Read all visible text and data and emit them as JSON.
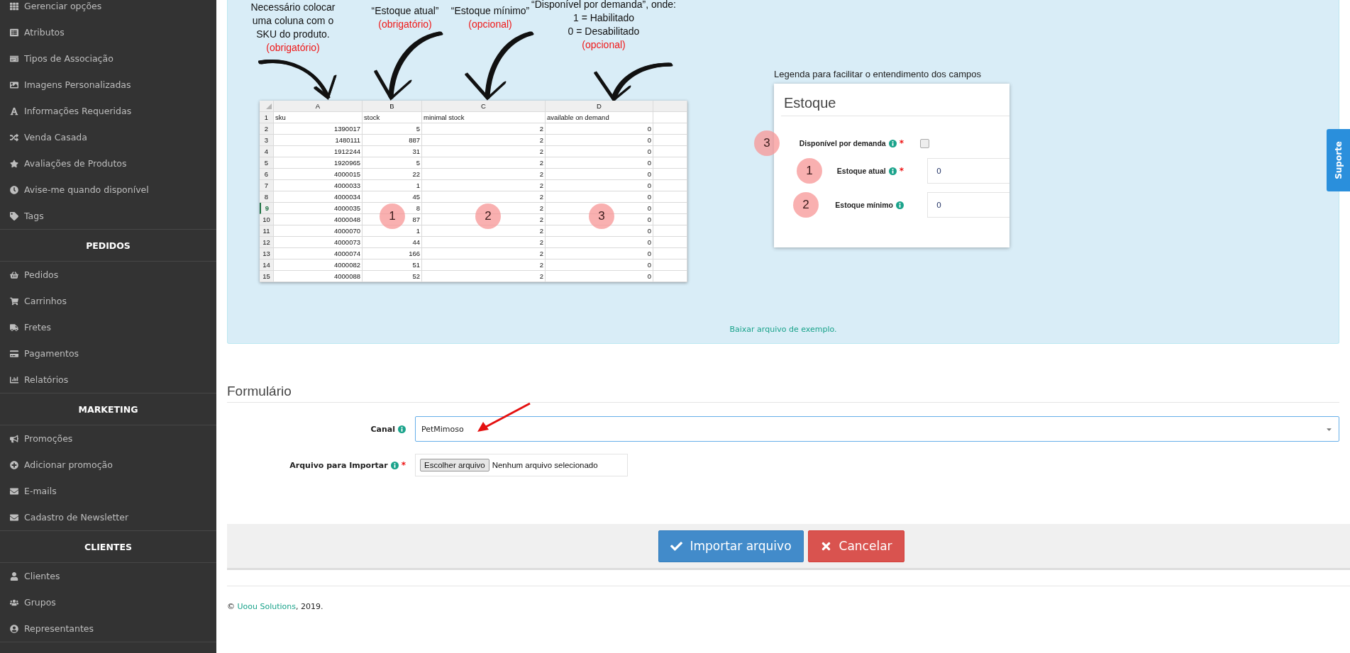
{
  "sidebar": {
    "sections": [
      {
        "items": [
          {
            "label": "Gerenciar opções"
          },
          {
            "label": "Atributos"
          },
          {
            "label": "Tipos de Associação"
          },
          {
            "label": "Imagens Personalizadas"
          },
          {
            "label": "Informações Requeridas"
          },
          {
            "label": "Venda Casada"
          },
          {
            "label": "Avaliações de Produtos"
          },
          {
            "label": "Avise-me quando disponível"
          },
          {
            "label": "Tags"
          }
        ]
      },
      {
        "title": "PEDIDOS",
        "items": [
          {
            "label": "Pedidos"
          },
          {
            "label": "Carrinhos"
          },
          {
            "label": "Fretes"
          },
          {
            "label": "Pagamentos"
          },
          {
            "label": "Relatórios"
          }
        ]
      },
      {
        "title": "MARKETING",
        "items": [
          {
            "label": "Promoções"
          },
          {
            "label": "Adicionar promoção"
          },
          {
            "label": "E-mails"
          },
          {
            "label": "Cadastro de Newsletter"
          }
        ]
      },
      {
        "title": "CLIENTES",
        "items": [
          {
            "label": "Clientes"
          },
          {
            "label": "Grupos"
          },
          {
            "label": "Representantes"
          }
        ]
      }
    ]
  },
  "instructions": {
    "notes": [
      {
        "lines": [
          "Necessário colocar",
          "uma coluna com o",
          "SKU do produto."
        ],
        "tag": "(obrigatório)"
      },
      {
        "lines": [
          "“Estoque atual”"
        ],
        "tag": "(obrigatório)"
      },
      {
        "lines": [
          "“Estoque mínimo”"
        ],
        "tag": "(opcional)"
      },
      {
        "lines": [
          "“Disponível por demanda”, onde:",
          "1 = Habilitado",
          "0 = Desabilitado"
        ],
        "tag": "(opcional)"
      }
    ],
    "spreadsheet": {
      "columns": [
        "A",
        "B",
        "C",
        "D"
      ],
      "rows": [
        {
          "cells": [
            "1",
            "sku",
            "stock",
            "minimal stock",
            "available on demand"
          ],
          "selected": false
        },
        {
          "cells": [
            "2",
            "1390017",
            "5",
            "2",
            "0"
          ],
          "selected": false
        },
        {
          "cells": [
            "3",
            "1480111",
            "887",
            "2",
            "0"
          ],
          "selected": false
        },
        {
          "cells": [
            "4",
            "1912244",
            "31",
            "2",
            "0"
          ],
          "selected": false
        },
        {
          "cells": [
            "5",
            "1920965",
            "5",
            "2",
            "0"
          ],
          "selected": false
        },
        {
          "cells": [
            "6",
            "4000015",
            "22",
            "2",
            "0"
          ],
          "selected": false
        },
        {
          "cells": [
            "7",
            "4000033",
            "1",
            "2",
            "0"
          ],
          "selected": false
        },
        {
          "cells": [
            "8",
            "4000034",
            "45",
            "2",
            "0"
          ],
          "selected": false
        },
        {
          "cells": [
            "9",
            "4000035",
            "8",
            "2",
            "0"
          ],
          "selected": true
        },
        {
          "cells": [
            "10",
            "4000048",
            "87",
            "2",
            "0"
          ],
          "selected": false
        },
        {
          "cells": [
            "11",
            "4000070",
            "1",
            "2",
            "0"
          ],
          "selected": false
        },
        {
          "cells": [
            "12",
            "4000073",
            "44",
            "2",
            "0"
          ],
          "selected": false
        },
        {
          "cells": [
            "13",
            "4000074",
            "166",
            "2",
            "0"
          ],
          "selected": false
        },
        {
          "cells": [
            "14",
            "4000082",
            "51",
            "2",
            "0"
          ],
          "selected": false
        },
        {
          "cells": [
            "15",
            "4000088",
            "52",
            "2",
            "0"
          ],
          "selected": false
        }
      ],
      "markers": [
        "1",
        "2",
        "3"
      ]
    },
    "legend": {
      "caption": "Legenda para facilitar o entendimento dos campos",
      "title": "Estoque",
      "fields": [
        {
          "kind": "checkbox",
          "marker": "3",
          "label": "Disponível por demanda",
          "required_mark": "*",
          "checked": false
        },
        {
          "kind": "input",
          "marker": "1",
          "label": "Estoque atual",
          "required_mark": "*",
          "value": "0"
        },
        {
          "kind": "input",
          "marker": "2",
          "label": "Estoque mínimo",
          "value": "0"
        }
      ]
    },
    "download_link": "Baixar arquivo de exemplo."
  },
  "form": {
    "title": "Formulário",
    "fields": [
      {
        "kind": "select",
        "label": "Canal",
        "value": "PetMimoso"
      },
      {
        "kind": "file",
        "label": "Arquivo para Importar",
        "required_mark": "*",
        "button": "Escolher arquivo",
        "status": "Nenhum arquivo selecionado"
      }
    ]
  },
  "buttons": [
    {
      "kind": "primary",
      "label": "Importar arquivo"
    },
    {
      "kind": "danger",
      "label": "Cancelar"
    }
  ],
  "footer": {
    "prefix": "©",
    "link": "Uoou Solutions",
    "suffix": ", 2019."
  },
  "support_tab": "Suporte"
}
